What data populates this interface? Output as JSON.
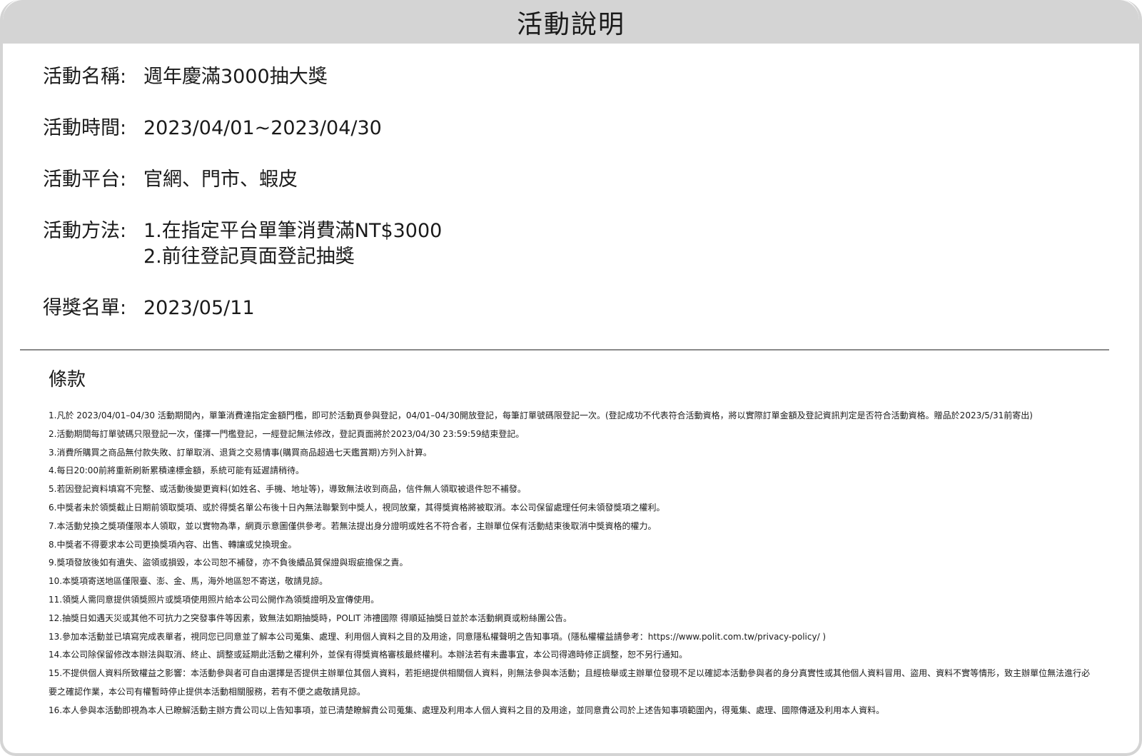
{
  "header": {
    "title": "活動說明"
  },
  "info": [
    {
      "label": "活動名稱:",
      "values": [
        "週年慶滿3000抽大獎"
      ]
    },
    {
      "label": "活動時間:",
      "values": [
        "2023/04/01~2023/04/30"
      ]
    },
    {
      "label": "活動平台:",
      "values": [
        "官網、門市、蝦皮"
      ]
    },
    {
      "label": "活動方法:",
      "values": [
        "1.在指定平台單筆消費滿NT$3000",
        "2.前往登記頁面登記抽獎"
      ]
    },
    {
      "label": "得獎名單:",
      "values": [
        "2023/05/11"
      ]
    }
  ],
  "terms": {
    "title": "條款",
    "items": [
      "1.凡於 2023/04/01–04/30 活動期間內，單筆消費達指定金額門檻，即可於活動頁參與登記，04/01–04/30開放登記，每筆訂單號碼限登記一次。(登記成功不代表符合活動資格，將以實際訂單金額及登記資訊判定是否符合活動資格。贈品於2023/5/31前寄出)",
      "2.活動期間每訂單號碼只限登記一次，僅擇一門檻登記，一經登記無法修改，登記頁面將於2023/04/30 23:59:59結束登記。",
      "3.消費所購買之商品無付款失敗、訂單取消、退貨之交易情事(購買商品超過七天鑑賞期)方列入計算。",
      "4.每日20:00前將重新刷新累積達標金額，系統可能有延遲請稍待。",
      "5.若因登記資料填寫不完整、或活動後變更資料(如姓名、手機、地址等)，導致無法收到商品，信件無人領取被退件恕不補發。",
      "6.中獎者未於領獎截止日期前領取獎項、或於得獎名單公布後十日內無法聯繫到中獎人，視同放棄，其得獎資格將被取消。本公司保留處理任何未領發獎項之權利。",
      "7.本活動兌換之獎項僅限本人領取，並以實物為準，網頁示意圖僅供參考。若無法提出身分證明或姓名不符合者，主辦單位保有活動結束後取消中獎資格的權力。",
      "8.中獎者不得要求本公司更換獎項內容、出售、轉讓或兌換現金。",
      "9.獎項發放後如有遺失、盜領或損毀，本公司恕不補發，亦不負後續品質保證與瑕疵擔保之責。",
      "10.本獎項寄送地區僅限臺、澎、金、馬，海外地區恕不寄送，敬請見諒。",
      "11.領獎人需同意提供領獎照片或獎項使用照片給本公司公開作為領獎證明及宣傳使用。",
      "12.抽獎日如遇天災或其他不可抗力之突發事件等因素，致無法如期抽獎時，POLIT 沛禮國際 得順延抽獎日並於本活動網頁或粉絲團公告。",
      "13.參加本活動並已填寫完成表單者，視同您已同意並了解本公司蒐集、處理、利用個人資料之目的及用途，同意隱私權聲明之告知事項。(隱私權權益請參考：https://www.polit.com.tw/privacy-policy/ )",
      "14.本公司除保留修改本辦法與取消、終止、調整或延期此活動之權利外，並保有得獎資格審核最終權利。本辦法若有未盡事宜，本公司得適時修正調整，恕不另行通知。",
      "15.不提供個人資料所致權益之影響：本活動參與者可自由選擇是否提供主辦單位其個人資料，若拒絕提供相關個人資料，則無法參與本活動；且經檢舉或主辦單位發現不足以確認本活動參與者的身分真實性或其他個人資料冒用、盜用、資料不實等情形，致主辦單位無法進行必要之確認作業，本公司有權暫時停止提供本活動相關服務，若有不便之處敬請見諒。",
      "16.本人參與本活動即視為本人已瞭解活動主辦方貴公司以上告知事項，並已清楚瞭解貴公司蒐集、處理及利用本人個人資料之目的及用途，並同意貴公司於上述告知事項範圍內，得蒐集、處理、國際傳遞及利用本人資料。"
    ]
  }
}
